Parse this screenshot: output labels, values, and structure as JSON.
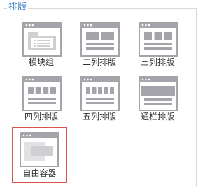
{
  "panel": {
    "legend": "排版"
  },
  "layouts": [
    {
      "label": "模块组",
      "icon": "module-group-icon",
      "selected": false
    },
    {
      "label": "二列排版",
      "icon": "two-column-icon",
      "selected": false
    },
    {
      "label": "三列排版",
      "icon": "three-column-icon",
      "selected": false
    },
    {
      "label": "四列排版",
      "icon": "four-column-icon",
      "selected": false
    },
    {
      "label": "五列排版",
      "icon": "five-column-icon",
      "selected": false
    },
    {
      "label": "通栏排版",
      "icon": "full-width-icon",
      "selected": false
    },
    {
      "label": "自由容器",
      "icon": "free-container-icon",
      "selected": true
    }
  ],
  "colors": {
    "legend": "#3b7fc4",
    "icon": "#a4a4aa",
    "selected_border": "#d9534f"
  }
}
